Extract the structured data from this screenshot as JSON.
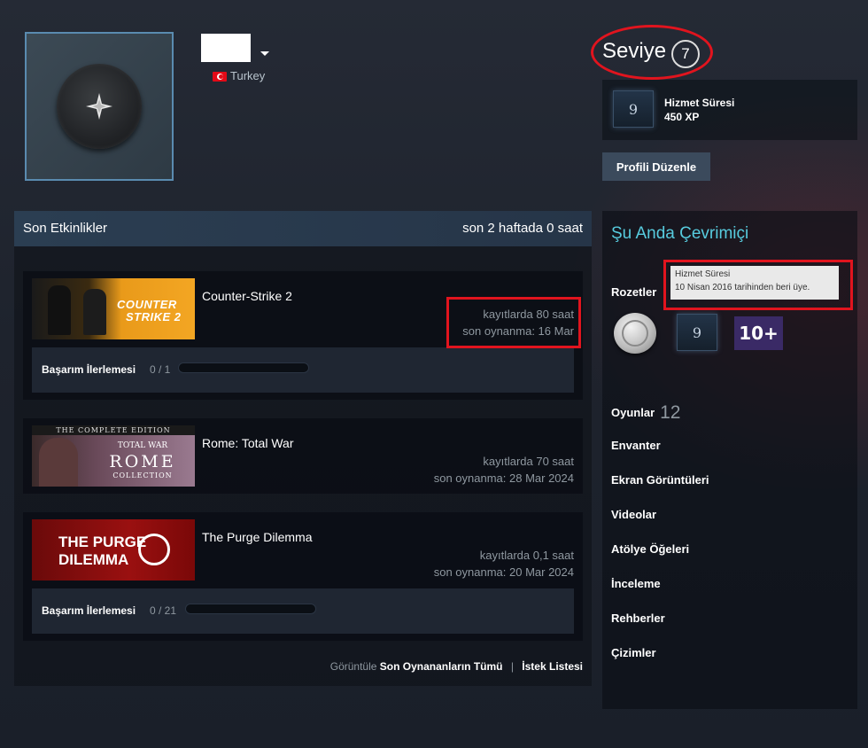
{
  "profile": {
    "country": "Turkey",
    "level_label": "Seviye",
    "level_value": "7",
    "badge": {
      "icon_text": "9",
      "title": "Hizmet Süresi",
      "xp": "450 XP"
    },
    "edit_button": "Profili Düzenle"
  },
  "activity": {
    "title": "Son Etkinlikler",
    "hours": "son 2 haftada 0 saat",
    "games": [
      {
        "name": "Counter-Strike 2",
        "capsule_text_1": "COUNTER",
        "capsule_text_2": "STRIKE 2",
        "hours": "kayıtlarda 80 saat",
        "last_played": "son oynanma: 16 Mar",
        "achievement_label": "Başarım İlerlemesi",
        "achievement_count": "0 / 1",
        "achievement_progress": 0
      },
      {
        "name": "Rome: Total War",
        "capsule_text_1": "THE COMPLETE EDITION",
        "capsule_text_2": "TOTAL WAR",
        "capsule_text_3": "ROME",
        "capsule_text_4": "COLLECTION",
        "hours": "kayıtlarda 70 saat",
        "last_played": "son oynanma: 28 Mar 2024"
      },
      {
        "name": "The Purge Dilemma",
        "capsule_text_1": "THE PURGE",
        "capsule_text_2": "DILEMMA",
        "hours": "kayıtlarda 0,1 saat",
        "last_played": "son oynanma: 20 Mar 2024",
        "achievement_label": "Başarım İlerlemesi",
        "achievement_count": "0 / 21",
        "achievement_progress": 0
      }
    ],
    "footer": {
      "view_label": "Görüntüle",
      "all_recent": "Son Oynananların Tümü",
      "separator": "|",
      "wishlist": "İstek Listesi"
    }
  },
  "sidebar": {
    "online_status": "Şu Anda Çevrimiçi",
    "badges_label": "Rozetler",
    "tooltip_title": "Hizmet Süresi",
    "tooltip_text": "10 Nisan 2016 tarihinden beri üye.",
    "badge_icon_text": "9",
    "badge_10_text": "10+",
    "games_label": "Oyunlar",
    "games_count": "12",
    "links": [
      "Envanter",
      "Ekran Görüntüleri",
      "Videolar",
      "Atölye Öğeleri",
      "İnceleme",
      "Rehberler",
      "Çizimler"
    ]
  },
  "colors": {
    "accent_online": "#57cbde",
    "highlight": "#e1141e",
    "button": "#3b4a5c"
  }
}
